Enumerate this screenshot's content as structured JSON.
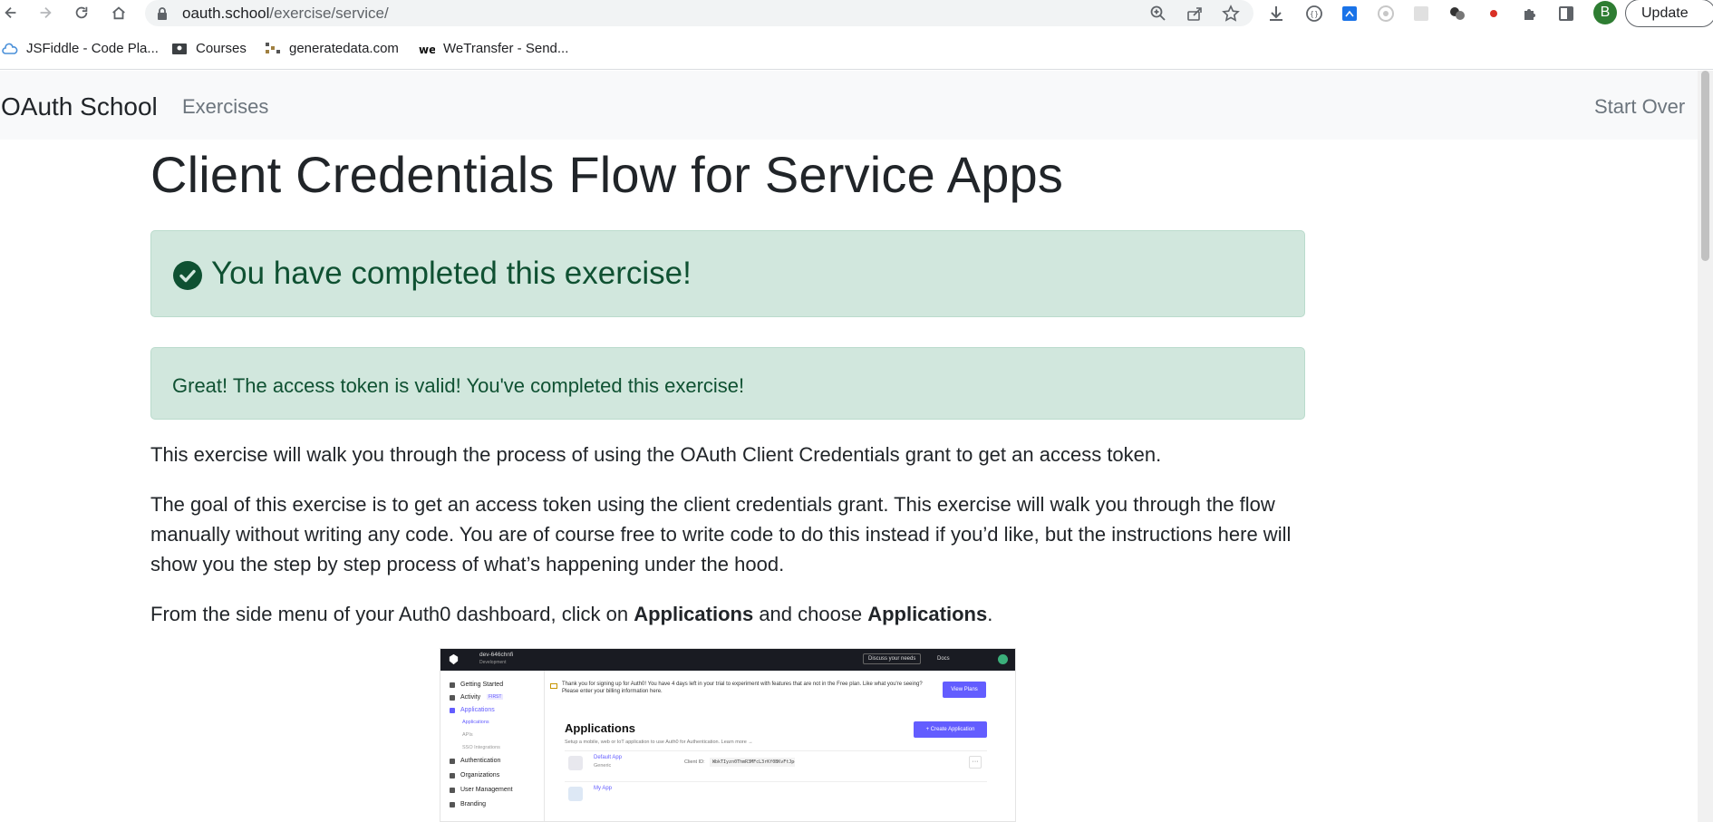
{
  "browser": {
    "url_host": "oauth.school",
    "url_path": "/exercise/service/",
    "profile_initial": "B",
    "update_label": "Update"
  },
  "bookmarks": [
    {
      "label": "JSFiddle - Code Pla..."
    },
    {
      "label": "Courses"
    },
    {
      "label": "generatedata.com"
    },
    {
      "label": "WeTransfer - Send..."
    }
  ],
  "navbar": {
    "brand": "OAuth School",
    "exercises": "Exercises",
    "start_over": "Start Over"
  },
  "page": {
    "title": "Client Credentials Flow for Service Apps",
    "completed_alert": "You have completed this exercise!",
    "valid_alert": "Great! The access token is valid! You've completed this exercise!",
    "para1": "This exercise will walk you through the process of using the OAuth Client Credentials grant to get an access token.",
    "para2": "The goal of this exercise is to get an access token using the client credentials grant. This exercise will walk you through the flow manually without writing any code. You are of course free to write code to do this instead if you’d like, but the instructions here will show you the step by step process of what’s happening under the hood.",
    "para3_prefix": "From the side menu of your Auth0 dashboard, click on ",
    "para3_bold1": "Applications",
    "para3_middle": " and choose ",
    "para3_bold2": "Applications",
    "para3_suffix": "."
  },
  "screenshot": {
    "tenant": "dev-646chnfi",
    "tenant_env": "Development",
    "discuss": "Discuss your needs",
    "docs": "Docs",
    "sidebar": {
      "getting_started": "Getting Started",
      "activity": "Activity",
      "activity_badge": "FIRST",
      "applications": "Applications",
      "sub_applications": "Applications",
      "sub_apis": "APIs",
      "sub_sso": "SSO Integrations",
      "authentication": "Authentication",
      "organizations": "Organizations",
      "user_management": "User Management",
      "branding": "Branding"
    },
    "banner": "Thank you for signing up for Auth0! You have 4 days left in your trial to experiment with features that are not in the Free plan. Like what you're seeing? Please enter your billing information here.",
    "view_plans": "View Plans",
    "apps_title": "Applications",
    "apps_sub": "Setup a mobile, web or IoT application to use Auth0 for Authentication. Learn more →",
    "create_app": "+ Create Application",
    "rows": [
      {
        "name": "Default App",
        "type": "Generic",
        "client_label": "Client ID:",
        "client_id": "WbkTIyzn0ThmR3MFcL3rKf0BKvFtJpc"
      },
      {
        "name": "My App",
        "type": "",
        "client_label": "",
        "client_id": ""
      }
    ]
  }
}
